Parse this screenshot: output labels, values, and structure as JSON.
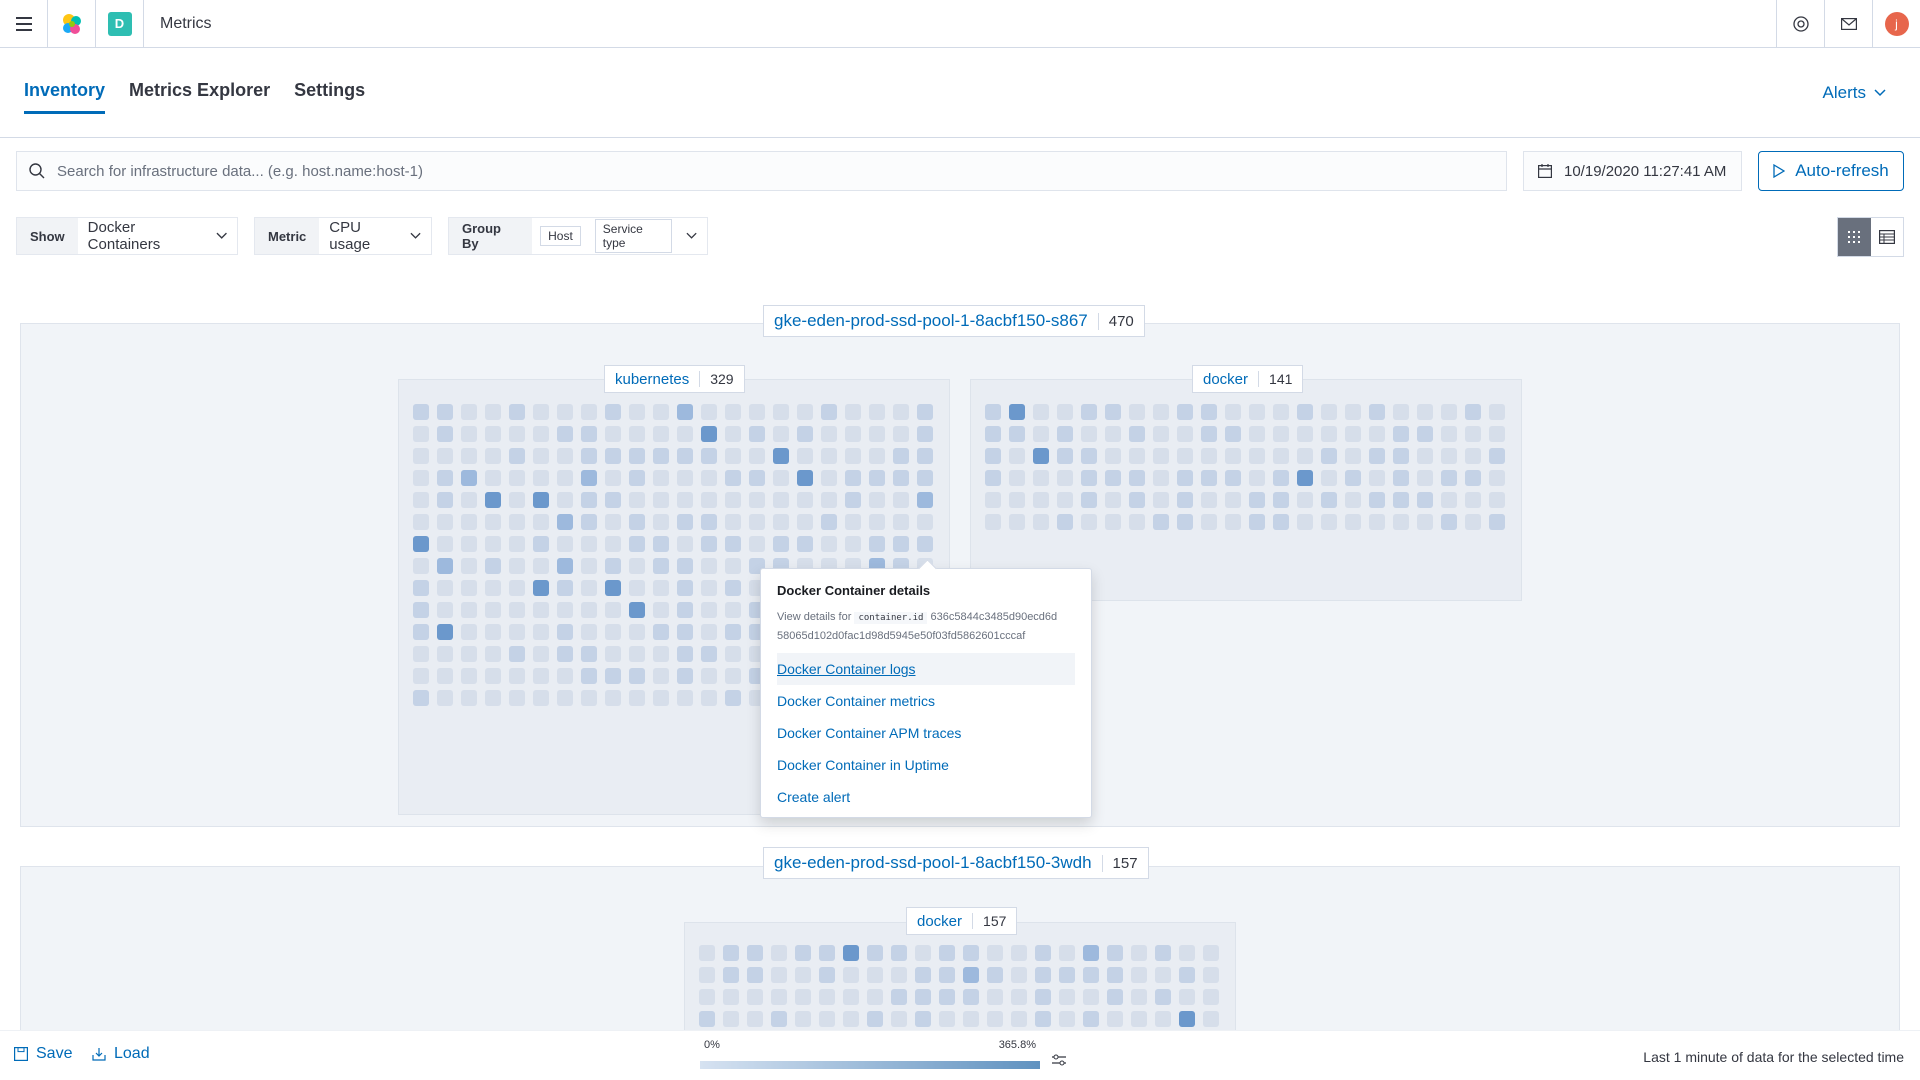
{
  "header": {
    "space_initial": "D",
    "app_title": "Metrics",
    "avatar_initial": "j"
  },
  "tabs": [
    {
      "label": "Inventory",
      "active": true
    },
    {
      "label": "Metrics Explorer",
      "active": false
    },
    {
      "label": "Settings",
      "active": false
    }
  ],
  "alerts_label": "Alerts",
  "search": {
    "placeholder": "Search for infrastructure data... (e.g. host.name:host-1)"
  },
  "date": "10/19/2020 11:27:41 AM",
  "auto_refresh_label": "Auto-refresh",
  "filters": {
    "show_label": "Show",
    "show_value": "Docker Containers",
    "metric_label": "Metric",
    "metric_value": "CPU usage",
    "groupby_label": "Group By",
    "groupby_chips": [
      "Host",
      "Service type"
    ]
  },
  "groups": [
    {
      "name": "gke-eden-prod-ssd-pool-1-8acbf150-s867",
      "count": "470",
      "subgroups": [
        {
          "name": "kubernetes",
          "count": "329"
        },
        {
          "name": "docker",
          "count": "141"
        }
      ]
    },
    {
      "name": "gke-eden-prod-ssd-pool-1-8acbf150-3wdh",
      "count": "157",
      "subgroups": [
        {
          "name": "docker",
          "count": "157"
        }
      ]
    }
  ],
  "popover": {
    "title": "Docker Container details",
    "view_prefix": "View details for",
    "field": "container.id",
    "id_part1": "636c5844c3485d90ecd6d",
    "id_part2": "58065d102d0fac1d98d5945e50f03fd5862601cccaf",
    "links": [
      "Docker Container logs",
      "Docker Container metrics",
      "Docker Container APM traces",
      "Docker Container in Uptime",
      "Create alert"
    ]
  },
  "bottom": {
    "save_label": "Save",
    "load_label": "Load",
    "legend_min": "0%",
    "legend_max": "365.8%",
    "status_text": "Last 1 minute of data for the selected time"
  },
  "colors": {
    "accent": "#006bb8",
    "legend_low": "#d6e2f1",
    "legend_high": "#6092c0"
  }
}
